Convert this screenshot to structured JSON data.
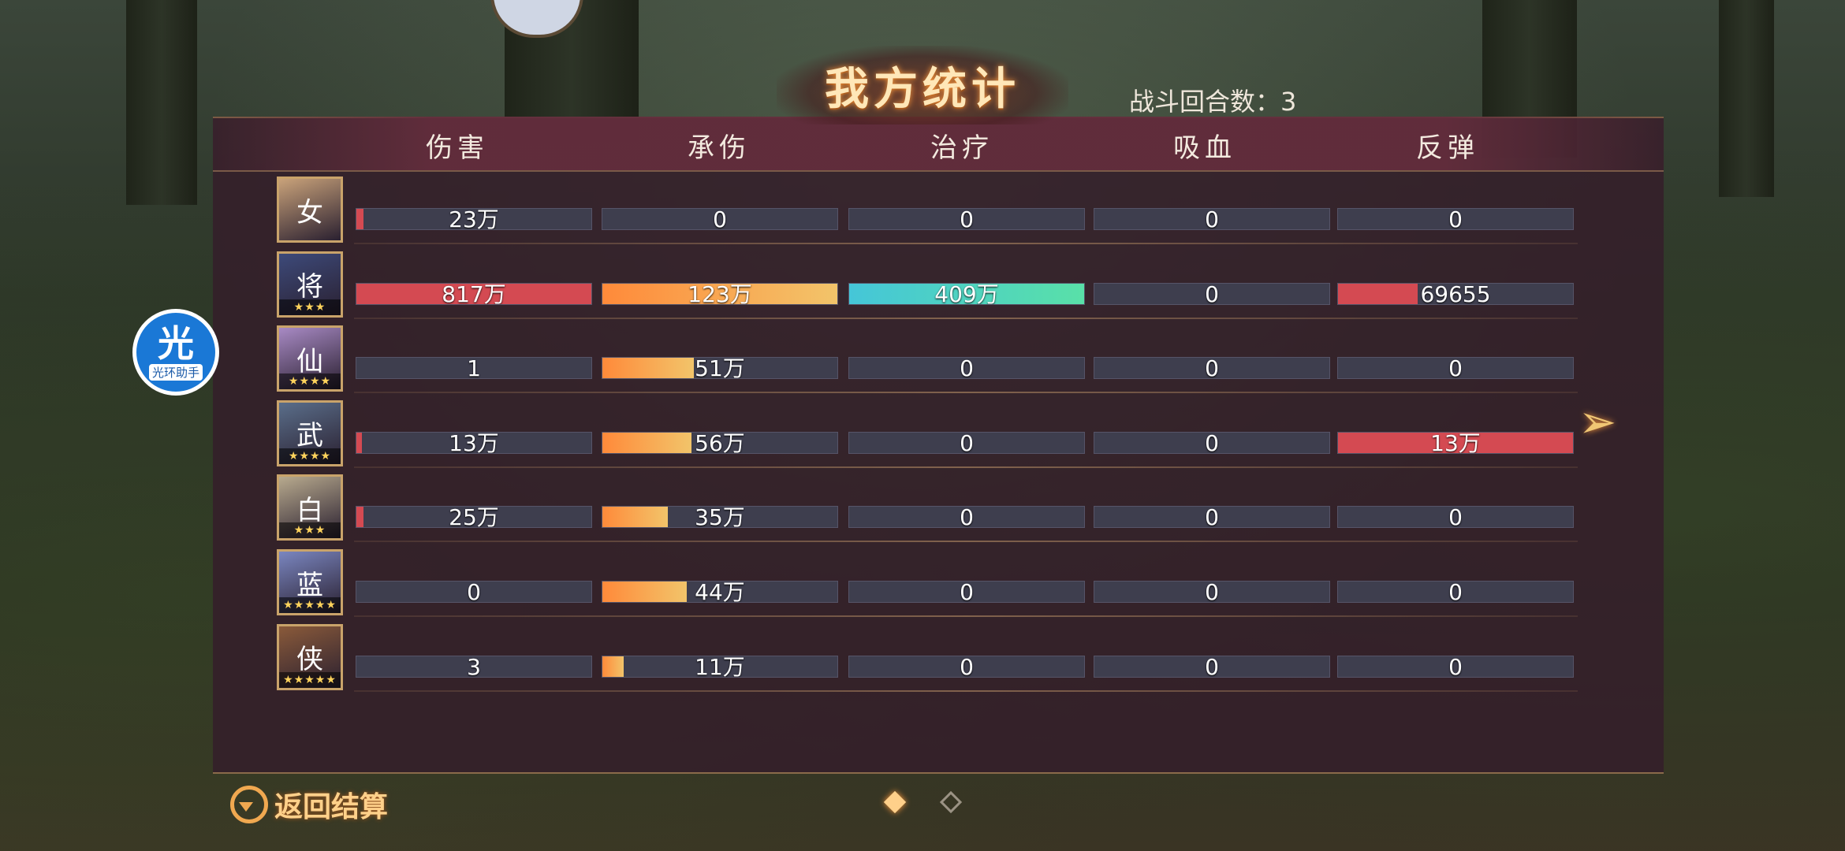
{
  "title": "我方统计",
  "rounds_label": "战斗回合数：3",
  "columns": [
    "伤害",
    "承伤",
    "治疗",
    "吸血",
    "反弹"
  ],
  "helper": {
    "icon_char": "光",
    "label": "光环助手"
  },
  "back_button": {
    "label": "返回结算"
  },
  "pager": {
    "current": 1,
    "total": 2
  },
  "colors": {
    "damage": "#d44a52",
    "taken_from": "#ff8a3a",
    "taken_to": "#f2c46a",
    "heal_from": "#45c6d8",
    "heal_to": "#59e0a8",
    "reflect": "#d44a52"
  },
  "rows": [
    {
      "avatar_glyph": "女",
      "avatar_bg": "#c9a27a",
      "stars": "",
      "damage": {
        "label": "23万",
        "fraction": 0.03
      },
      "taken": {
        "label": "0",
        "fraction": 0
      },
      "heal": {
        "label": "0",
        "fraction": 0
      },
      "lifesteal": {
        "label": "0",
        "fraction": 0
      },
      "reflect": {
        "label": "0",
        "fraction": 0
      }
    },
    {
      "avatar_glyph": "将",
      "avatar_bg": "#3d4a7a",
      "stars": "★★★",
      "damage": {
        "label": "817万",
        "fraction": 1.0
      },
      "taken": {
        "label": "123万",
        "fraction": 1.0
      },
      "heal": {
        "label": "409万",
        "fraction": 1.0
      },
      "lifesteal": {
        "label": "0",
        "fraction": 0
      },
      "reflect": {
        "label": "69655",
        "fraction": 0.34
      }
    },
    {
      "avatar_glyph": "仙",
      "avatar_bg": "#a88ac4",
      "stars": "★★★★",
      "damage": {
        "label": "1",
        "fraction": 0
      },
      "taken": {
        "label": "51万",
        "fraction": 0.39
      },
      "heal": {
        "label": "0",
        "fraction": 0
      },
      "lifesteal": {
        "label": "0",
        "fraction": 0
      },
      "reflect": {
        "label": "0",
        "fraction": 0
      }
    },
    {
      "avatar_glyph": "武",
      "avatar_bg": "#5a6e8a",
      "stars": "★★★★",
      "damage": {
        "label": "13万",
        "fraction": 0.015
      },
      "taken": {
        "label": "56万",
        "fraction": 0.38
      },
      "heal": {
        "label": "0",
        "fraction": 0
      },
      "lifesteal": {
        "label": "0",
        "fraction": 0
      },
      "reflect": {
        "label": "13万",
        "fraction": 1.0
      }
    },
    {
      "avatar_glyph": "白",
      "avatar_bg": "#b8aa8e",
      "stars": "★★★",
      "damage": {
        "label": "25万",
        "fraction": 0.03
      },
      "taken": {
        "label": "35万",
        "fraction": 0.28
      },
      "heal": {
        "label": "0",
        "fraction": 0
      },
      "lifesteal": {
        "label": "0",
        "fraction": 0
      },
      "reflect": {
        "label": "0",
        "fraction": 0
      }
    },
    {
      "avatar_glyph": "蓝",
      "avatar_bg": "#7a86c0",
      "stars": "★★★★★",
      "damage": {
        "label": "0",
        "fraction": 0
      },
      "taken": {
        "label": "44万",
        "fraction": 0.36
      },
      "heal": {
        "label": "0",
        "fraction": 0
      },
      "lifesteal": {
        "label": "0",
        "fraction": 0
      },
      "reflect": {
        "label": "0",
        "fraction": 0
      }
    },
    {
      "avatar_glyph": "侠",
      "avatar_bg": "#8a5a3a",
      "stars": "★★★★★",
      "damage": {
        "label": "3",
        "fraction": 0
      },
      "taken": {
        "label": "11万",
        "fraction": 0.09
      },
      "heal": {
        "label": "0",
        "fraction": 0
      },
      "lifesteal": {
        "label": "0",
        "fraction": 0
      },
      "reflect": {
        "label": "0",
        "fraction": 0
      }
    }
  ]
}
